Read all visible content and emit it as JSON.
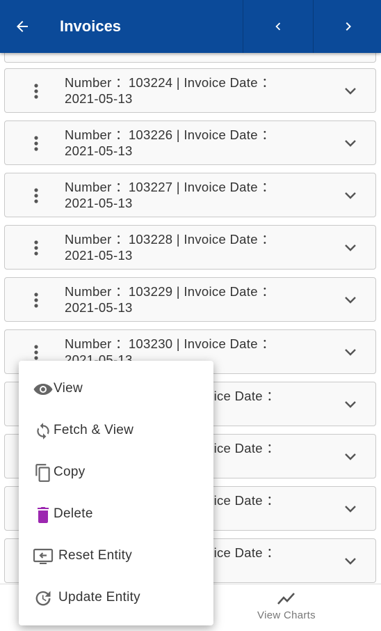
{
  "appbar": {
    "title": "Invoices",
    "back_icon": "arrow-left-icon",
    "prev_icon": "chevron-left-icon",
    "next_icon": "chevron-right-icon",
    "color": "#0b4a99"
  },
  "invoices": [
    {
      "line1": "Number ：103224 | Invoice Date ：",
      "line2": "2021-05-13"
    },
    {
      "line1": "Number ：103226 | Invoice Date ：",
      "line2": "2021-05-13"
    },
    {
      "line1": "Number ：103227 | Invoice Date ：",
      "line2": "2021-05-13"
    },
    {
      "line1": "Number ：103228 | Invoice Date ：",
      "line2": "2021-05-13"
    },
    {
      "line1": "Number ：103229 | Invoice Date ：",
      "line2": "2021-05-13"
    },
    {
      "line1": "Number ：103230 | Invoice Date ：",
      "line2": "2021-05-13"
    },
    {
      "line1": "oice Date ：",
      "line2": ""
    },
    {
      "line1": "oice Date ：",
      "line2": ""
    },
    {
      "line1": "oice Date ：",
      "line2": ""
    },
    {
      "line1": "oice Date ：",
      "line2": ""
    }
  ],
  "context_menu": {
    "items": [
      {
        "label": "View",
        "icon": "eye-icon"
      },
      {
        "label": "Fetch & View",
        "icon": "refresh-icon"
      },
      {
        "label": "Copy",
        "icon": "copy-icon"
      },
      {
        "label": "Delete",
        "icon": "trash-icon",
        "color": "#9c27b0"
      },
      {
        "label": "Reset Entity",
        "icon": "reset-screen-icon"
      },
      {
        "label": "Update Entity",
        "icon": "update-clock-icon"
      }
    ]
  },
  "bottom_bar": {
    "view_charts_label": "View Charts",
    "icon": "line-chart-icon"
  }
}
